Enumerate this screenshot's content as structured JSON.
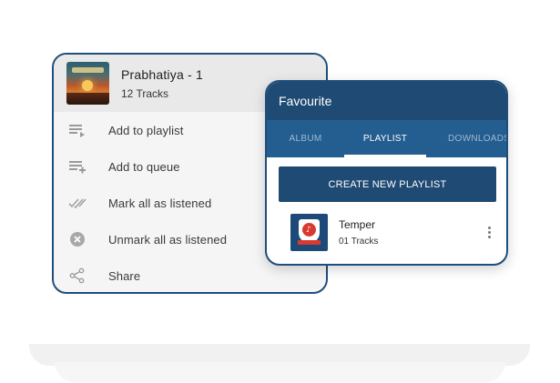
{
  "menu_card": {
    "album_title": "Prabhatiya - 1",
    "track_count": "12 Tracks",
    "album_art_icon": "album-art-sunset",
    "items": [
      {
        "label": "Add to playlist",
        "icon": "playlist-add-icon"
      },
      {
        "label": "Add to queue",
        "icon": "queue-add-icon"
      },
      {
        "label": "Mark all as listened",
        "icon": "double-check-icon"
      },
      {
        "label": "Unmark all as listened",
        "icon": "cancel-circle-icon"
      },
      {
        "label": "Share",
        "icon": "share-icon"
      }
    ]
  },
  "fav_card": {
    "title": "Favourite",
    "tabs": [
      {
        "label": "ALBUM",
        "active": false
      },
      {
        "label": "PLAYLIST",
        "active": true
      },
      {
        "label": "DOWNLOADS",
        "active": false
      }
    ],
    "create_button_label": "CREATE NEW PLAYLIST",
    "playlists": [
      {
        "name": "Temper",
        "count": "01 Tracks",
        "icon": "temple-badge-art"
      }
    ]
  },
  "colors": {
    "primary_dark": "#1f4a73",
    "tab_bar": "#245d8f",
    "border": "#1e4e7c",
    "menu_bg": "#f5f5f5"
  }
}
